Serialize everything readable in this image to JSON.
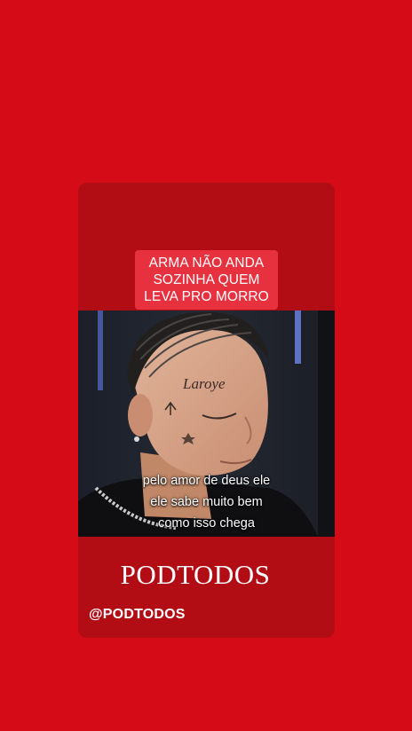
{
  "story": {
    "headline_lines": [
      "ARMA NÃO ANDA",
      "SOZINHA QUEM",
      "LEVA PRO MORRO"
    ],
    "subtitle_lines": [
      "pelo amor de deus ele",
      "ele sabe muito bem",
      "como isso chega"
    ],
    "brand": "PODTODOS",
    "handle": "@PODTODOS"
  },
  "colors": {
    "background": "#d50b18",
    "card": "#b20d15",
    "headline_box": "#e8313f"
  }
}
